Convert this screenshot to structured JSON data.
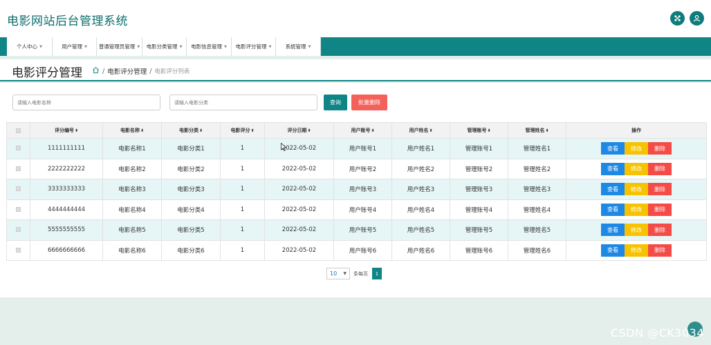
{
  "header": {
    "title": "电影网站后台管理系统",
    "icons": [
      "share-icon",
      "user-icon"
    ]
  },
  "nav": {
    "items": [
      {
        "label": "个人中心"
      },
      {
        "label": "用户管理"
      },
      {
        "label": "普通管理员管理"
      },
      {
        "label": "电影分类管理"
      },
      {
        "label": "电影信息管理"
      },
      {
        "label": "电影评分管理"
      },
      {
        "label": "系统管理"
      }
    ]
  },
  "breadcrumb": {
    "page_title": "电影评分管理",
    "level1": "电影评分管理",
    "level2": "电影评分列表",
    "sep": "/"
  },
  "search": {
    "name_placeholder": "请输入电影名称",
    "category_placeholder": "请输入电影分类",
    "query_label": "查询",
    "batch_delete_label": "批量删除"
  },
  "table": {
    "headers": [
      "评分编号",
      "电影名称",
      "电影分类",
      "电影评分",
      "评分日期",
      "用户账号",
      "用户姓名",
      "管理账号",
      "管理姓名",
      "操作"
    ],
    "sort_glyph": "⬍",
    "rows": [
      [
        "1111111111",
        "电影名称1",
        "电影分类1",
        "1",
        "2022-05-02",
        "用户账号1",
        "用户姓名1",
        "管理账号1",
        "管理姓名1"
      ],
      [
        "2222222222",
        "电影名称2",
        "电影分类2",
        "1",
        "2022-05-02",
        "用户账号2",
        "用户姓名2",
        "管理账号2",
        "管理姓名2"
      ],
      [
        "3333333333",
        "电影名称3",
        "电影分类3",
        "1",
        "2022-05-02",
        "用户账号3",
        "用户姓名3",
        "管理账号3",
        "管理姓名3"
      ],
      [
        "4444444444",
        "电影名称4",
        "电影分类4",
        "1",
        "2022-05-02",
        "用户账号4",
        "用户姓名4",
        "管理账号4",
        "管理姓名4"
      ],
      [
        "5555555555",
        "电影名称5",
        "电影分类5",
        "1",
        "2022-05-02",
        "用户账号5",
        "用户姓名5",
        "管理账号5",
        "管理姓名5"
      ],
      [
        "6666666666",
        "电影名称6",
        "电影分类6",
        "1",
        "2022-05-02",
        "用户账号6",
        "用户姓名6",
        "管理账号6",
        "管理姓名6"
      ]
    ],
    "actions": {
      "view": "查看",
      "edit": "修改",
      "delete": "删除"
    }
  },
  "pagination": {
    "page_size": "10",
    "page_size_label": "条每页",
    "current_page": "1"
  },
  "watermark": "CSDN @CK3034",
  "colors": {
    "primary": "#0f8585",
    "view": "#1e88e5",
    "edit": "#f7c300",
    "delete": "#f44b47",
    "row_alt": "#e6f5f6"
  }
}
